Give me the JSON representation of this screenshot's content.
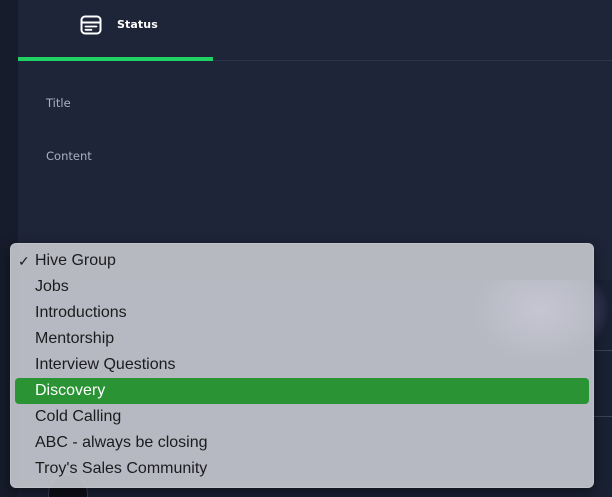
{
  "composer": {
    "tabs": [
      {
        "label": "Status",
        "icon": "status-card-icon",
        "active": true
      }
    ],
    "title_placeholder": "Title",
    "content_placeholder": "Content",
    "accent_color": "#1fd263"
  },
  "group_menu": {
    "checked_item": "Hive Group",
    "highlighted_item": "Discovery",
    "highlight_color": "#2a9333",
    "items": [
      {
        "label": "Hive Group"
      },
      {
        "label": "Jobs"
      },
      {
        "label": "Introductions"
      },
      {
        "label": "Mentorship"
      },
      {
        "label": "Interview Questions"
      },
      {
        "label": "Discovery"
      },
      {
        "label": "Cold Calling"
      },
      {
        "label": "ABC - always be closing"
      },
      {
        "label": "Troy's Sales Community"
      }
    ]
  }
}
